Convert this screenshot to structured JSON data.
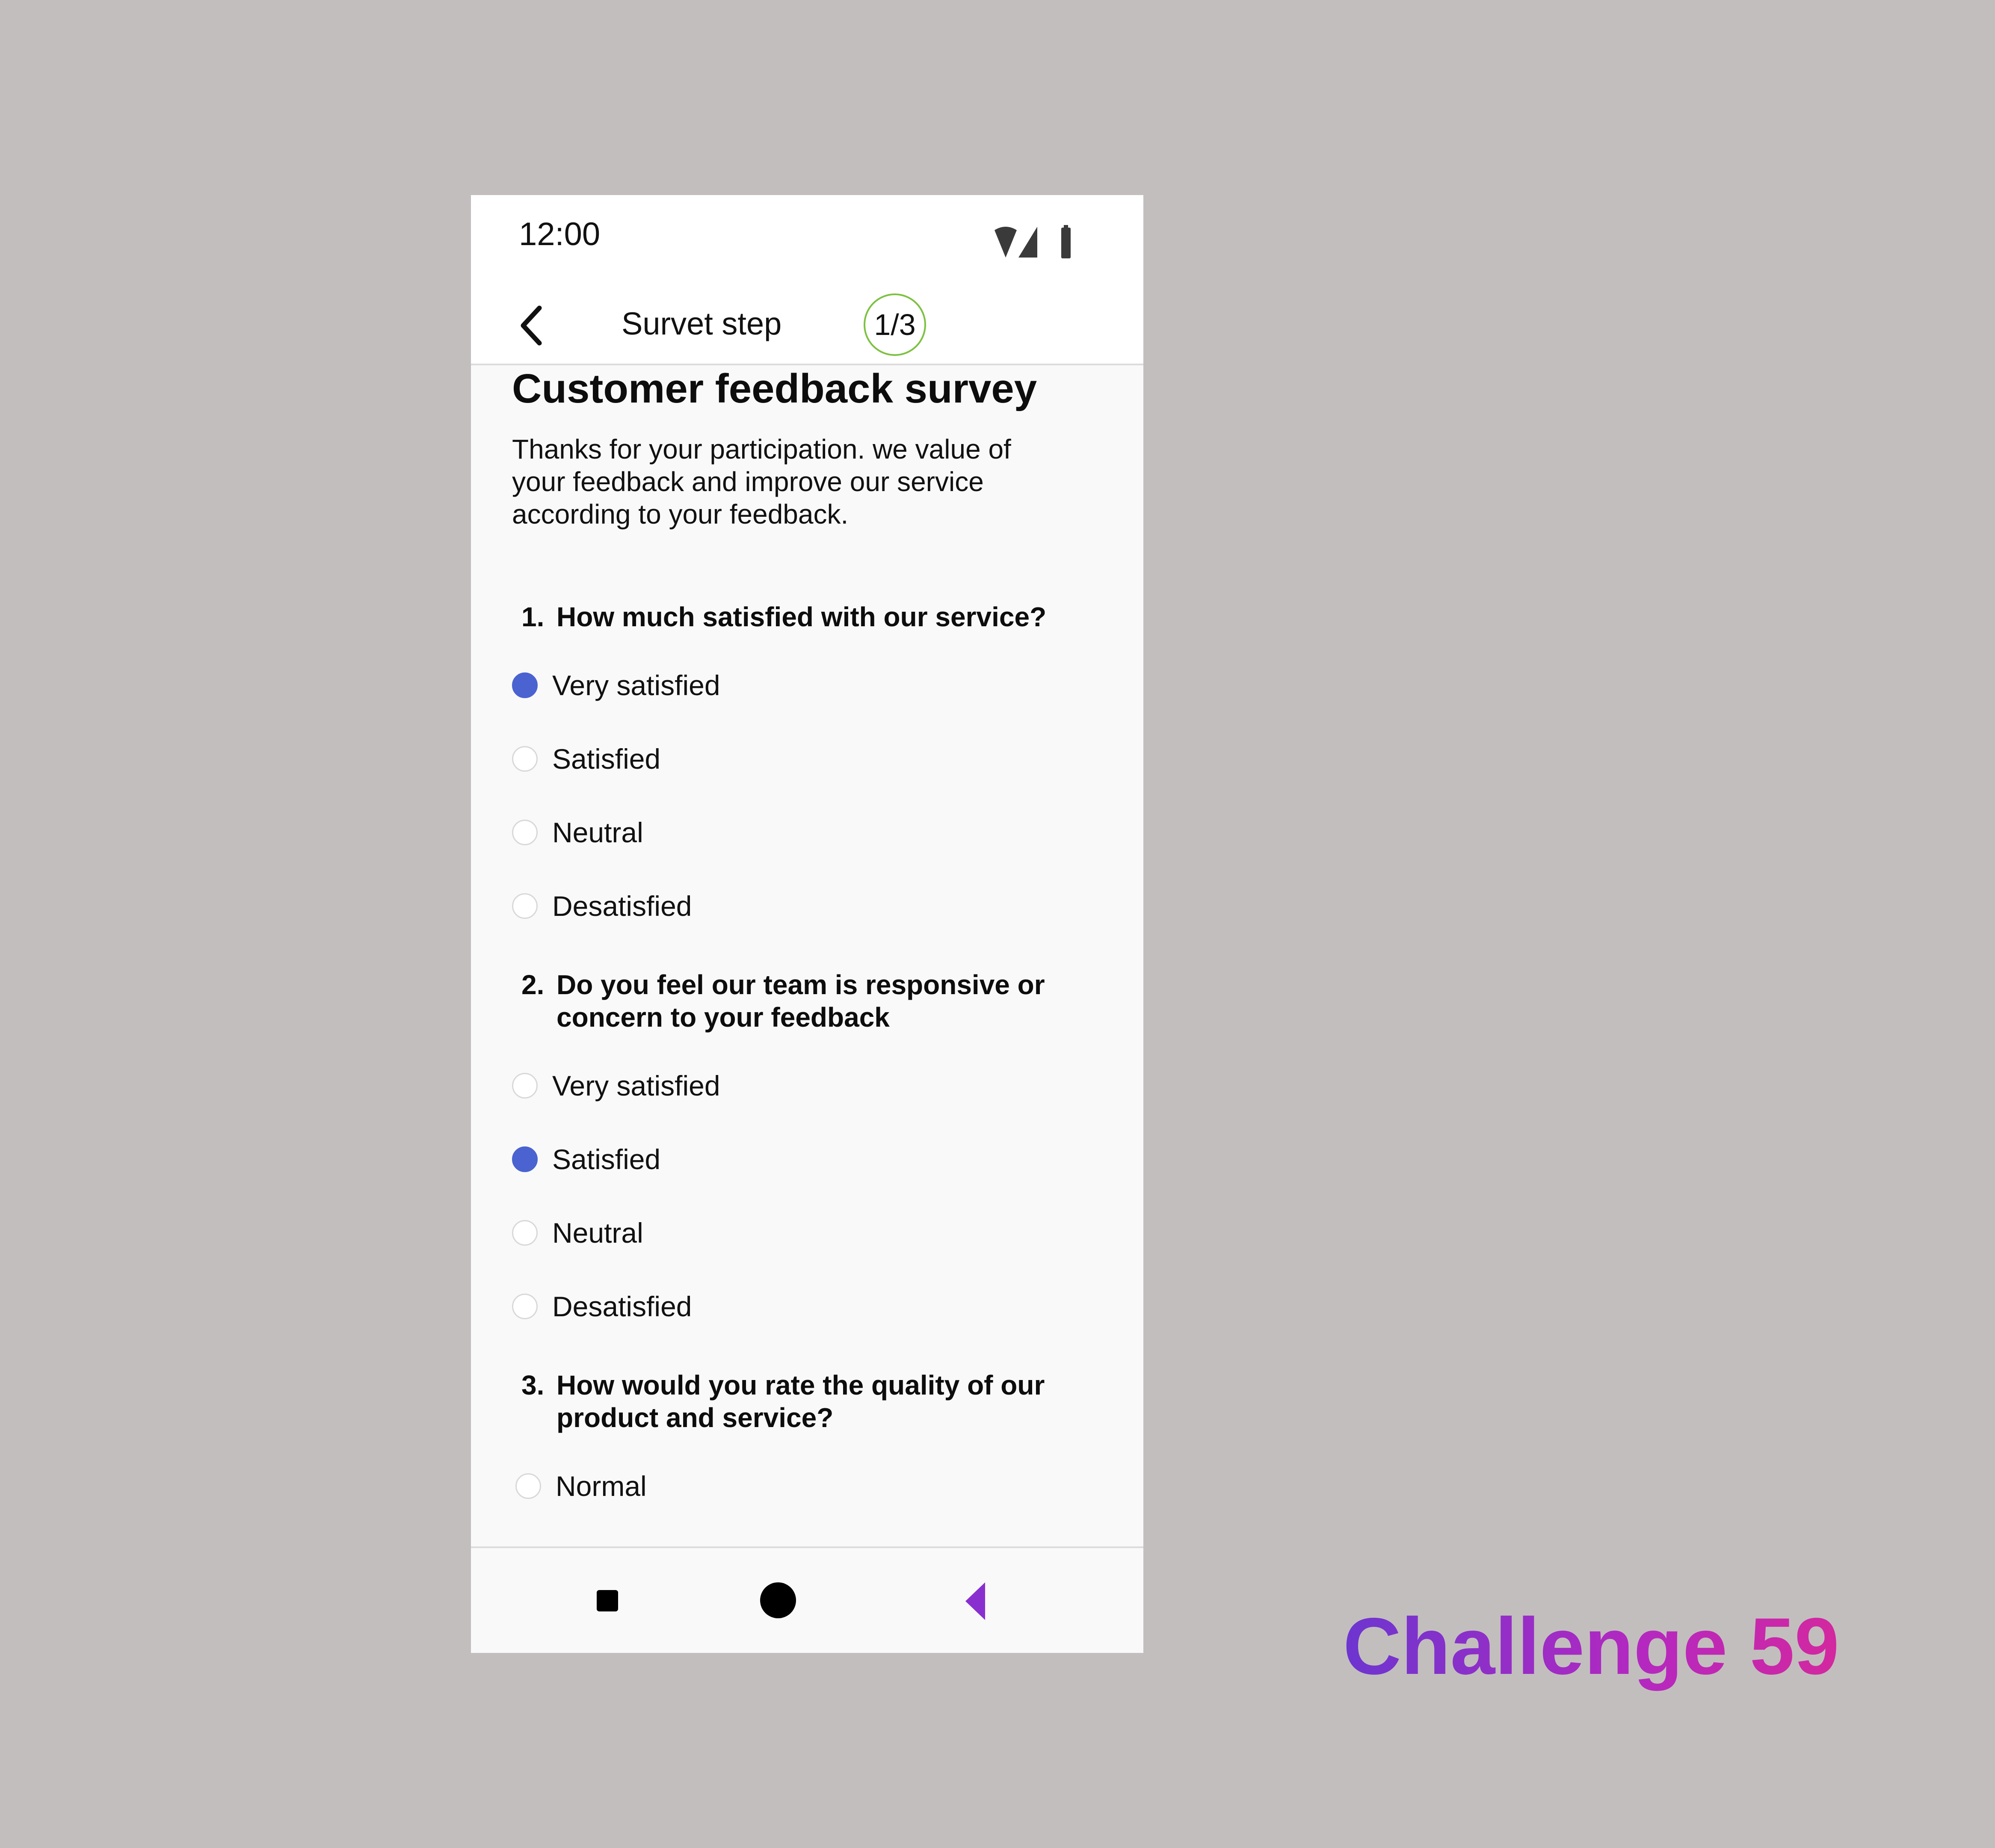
{
  "status_bar": {
    "time": "12:00"
  },
  "app_bar": {
    "title": "Survet step",
    "step": "1/3"
  },
  "survey": {
    "title": "Customer feedback survey",
    "description": "Thanks for your participation. we value of your feedback and improve our service according to your feedback.",
    "questions": [
      {
        "number": "1.",
        "text": "How much  satisfied with our service?",
        "options": [
          {
            "label": "Very satisfied",
            "selected": true
          },
          {
            "label": "Satisfied",
            "selected": false
          },
          {
            "label": "Neutral",
            "selected": false
          },
          {
            "label": "Desatisfied",
            "selected": false
          }
        ]
      },
      {
        "number": "2.",
        "text": "Do you feel our team is responsive or concern to your feedback",
        "options": [
          {
            "label": "Very satisfied",
            "selected": false
          },
          {
            "label": "Satisfied",
            "selected": true
          },
          {
            "label": "Neutral",
            "selected": false
          },
          {
            "label": "Desatisfied",
            "selected": false
          }
        ]
      },
      {
        "number": "3.",
        "text": "How would you rate the quality of our product and service?",
        "options": [
          {
            "label": "Normal",
            "selected": false
          }
        ]
      }
    ]
  },
  "nav_bar": {
    "recents_icon": "square-icon",
    "home_icon": "circle-icon",
    "back_icon": "triangle-back-icon"
  },
  "colors": {
    "background": "#c3bebe",
    "radio_selected": "#4a63d0",
    "step_ring": "#7dc142",
    "nav_back": "#8a2fcf"
  },
  "caption": "Challenge 59"
}
